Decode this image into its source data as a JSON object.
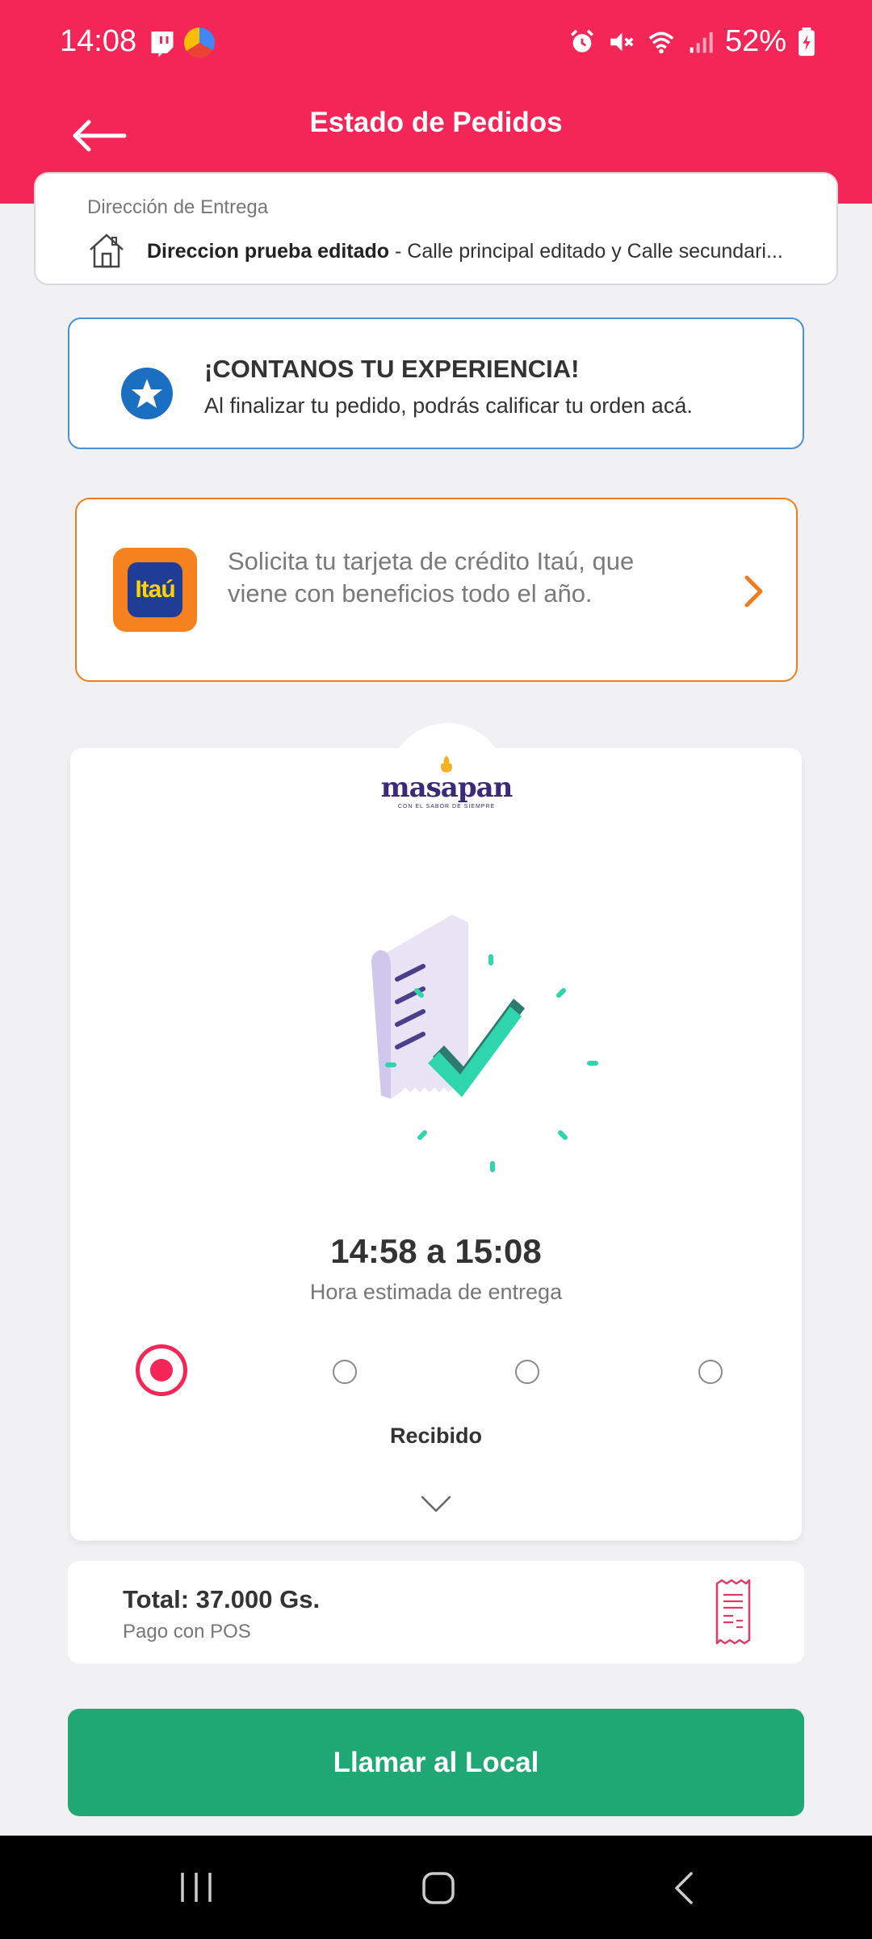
{
  "status_bar": {
    "time": "14:08",
    "battery": "52%"
  },
  "header": {
    "title": "Estado de Pedidos",
    "background_color": "#f42658"
  },
  "delivery_address": {
    "label": "Dirección de Entrega",
    "name": "Direccion prueba editado",
    "detail": " - Calle principal editado y Calle secundari..."
  },
  "experience_card": {
    "title": "¡CONTANOS TU EXPERIENCIA!",
    "subtitle": "Al finalizar tu pedido, podrás calificar tu orden acá.",
    "icon": "star-icon"
  },
  "promo_card": {
    "logo_text": "Itaú",
    "text": "Solicita tu tarjeta de crédito Itaú, que viene con beneficios todo el año.",
    "accent_color": "#f07d1b"
  },
  "order_status": {
    "brand": "masapan",
    "brand_tagline": "CON EL SABOR DE SIEMPRE",
    "eta": "14:58 a 15:08",
    "eta_label": "Hora estimada de entrega",
    "steps_total": 4,
    "active_step": 1,
    "current_step_label": "Recibido"
  },
  "totals": {
    "amount": "Total: 37.000 Gs.",
    "payment_method": "Pago con POS"
  },
  "actions": {
    "call_button": "Llamar al Local",
    "call_color": "#1fa874"
  }
}
